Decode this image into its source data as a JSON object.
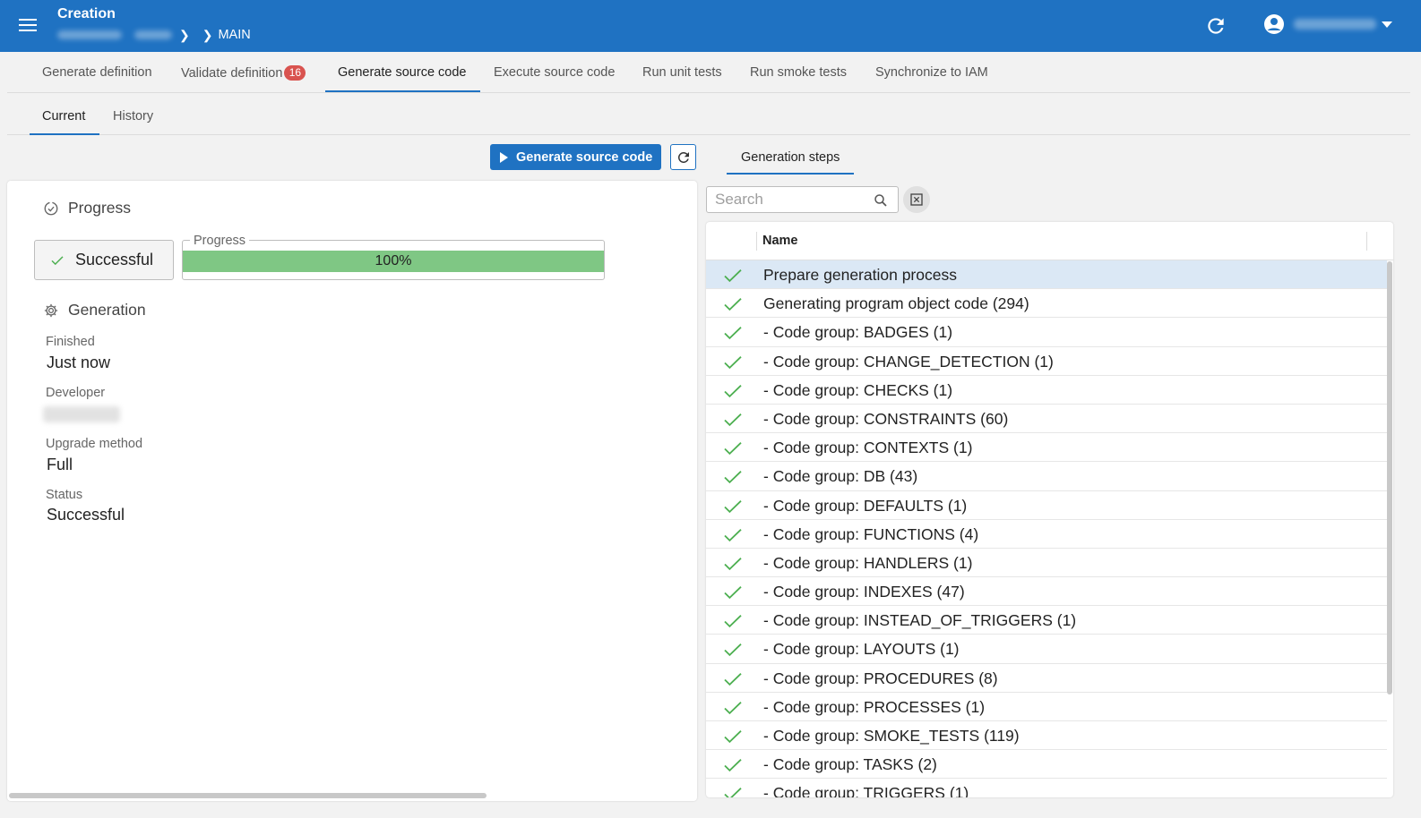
{
  "header": {
    "title": "Creation",
    "breadcrumb_current": "MAIN"
  },
  "tabs": [
    {
      "label": "Generate definition"
    },
    {
      "label": "Validate definition",
      "badge": "16"
    },
    {
      "label": "Generate source code",
      "active": true
    },
    {
      "label": "Execute source code"
    },
    {
      "label": "Run unit tests"
    },
    {
      "label": "Run smoke tests"
    },
    {
      "label": "Synchronize to IAM"
    }
  ],
  "subtabs": [
    {
      "label": "Current",
      "active": true
    },
    {
      "label": "History"
    }
  ],
  "toolbar": {
    "generate_label": "Generate source code"
  },
  "progress_section": {
    "heading": "Progress",
    "status": "Successful",
    "progress_legend": "Progress",
    "progress_value": 1.0,
    "progress_text": "100%"
  },
  "generation_section": {
    "heading": "Generation",
    "finished_label": "Finished",
    "finished_value": "Just now",
    "developer_label": "Developer",
    "upgrade_label": "Upgrade method",
    "upgrade_value": "Full",
    "status_label": "Status",
    "status_value": "Successful"
  },
  "steps_panel": {
    "tab_label": "Generation steps",
    "search_placeholder": "Search",
    "column_name": "Name",
    "rows": [
      "Prepare generation process",
      "Generating program object code (294)",
      "- Code group: BADGES (1)",
      "- Code group: CHANGE_DETECTION (1)",
      "- Code group: CHECKS (1)",
      "- Code group: CONSTRAINTS (60)",
      "- Code group: CONTEXTS (1)",
      "- Code group: DB (43)",
      "- Code group: DEFAULTS (1)",
      "- Code group: FUNCTIONS (4)",
      "- Code group: HANDLERS (1)",
      "- Code group: INDEXES (47)",
      "- Code group: INSTEAD_OF_TRIGGERS (1)",
      "- Code group: LAYOUTS (1)",
      "- Code group: PROCEDURES (8)",
      "- Code group: PROCESSES (1)",
      "- Code group: SMOKE_TESTS (119)",
      "- Code group: TASKS (2)",
      "- Code group: TRIGGERS (1)"
    ]
  },
  "colors": {
    "primary": "#1f72c2",
    "success": "#4caf50",
    "progress_fill": "#7fc784",
    "badge": "#d9534f"
  }
}
